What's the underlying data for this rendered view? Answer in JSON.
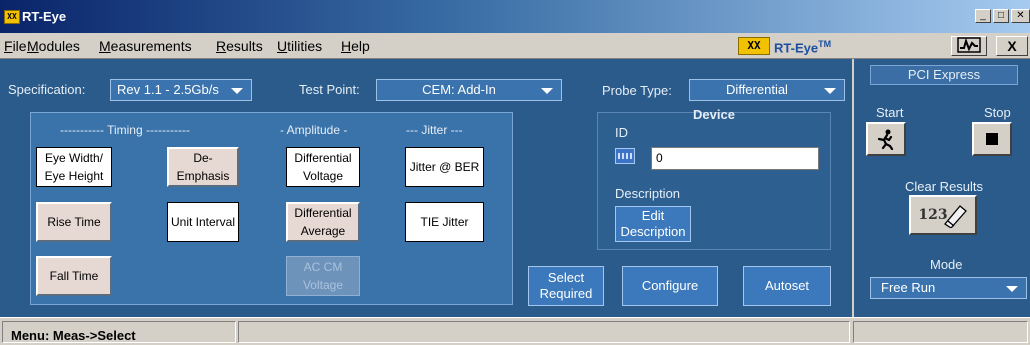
{
  "window": {
    "title": "RT-Eye",
    "logo_text": "XX",
    "controls": [
      "_",
      "□",
      "✕"
    ]
  },
  "menu": {
    "items": [
      "File",
      "Modules",
      "Measurements",
      "Results",
      "Utilities",
      "Help"
    ],
    "brand_logo": "XX",
    "brand_name": "RT-Eye",
    "brand_tm": "TM",
    "close_label": "X"
  },
  "settings": {
    "specification_label": "Specification:",
    "specification_value": "Rev 1.1 - 2.5Gb/s",
    "test_point_label": "Test Point:",
    "test_point_value": "CEM: Add-In",
    "probe_type_label": "Probe Type:",
    "probe_type_value": "Differential"
  },
  "measurements": {
    "groups": {
      "timing": "----------- Timing -----------",
      "amplitude": "- Amplitude -",
      "jitter": "--- Jitter ---"
    },
    "buttons": {
      "eye_width": "Eye Width/ Eye Height",
      "de_emphasis": "De- Emphasis",
      "rise_time": "Rise Time",
      "unit_interval": "Unit Interval",
      "fall_time": "Fall Time",
      "diff_voltage": "Differential Voltage",
      "diff_average": "Differential Average",
      "ac_cm_voltage": "AC CM Voltage",
      "jitter_ber": "Jitter @ BER",
      "tie_jitter": "TIE Jitter"
    }
  },
  "device": {
    "title": "Device",
    "id_label": "ID",
    "id_value": "0",
    "description_label": "Description",
    "edit_description": "Edit Description"
  },
  "actions": {
    "select_required": "Select Required",
    "configure": "Configure",
    "autoset": "Autoset"
  },
  "control_panel": {
    "header": "PCI Express",
    "start_label": "Start",
    "stop_label": "Stop",
    "clear_results_label": "Clear Results",
    "clear_results_icon_text": "123",
    "mode_label": "Mode",
    "mode_value": "Free Run"
  },
  "status": {
    "text": "Menu: Meas->Select"
  },
  "colors": {
    "panel_bg": "#2a5b8a",
    "meas_box_bg": "#3a72aa",
    "dropdown_bg": "#3a73ad",
    "accent_tan": "#e6d8d2",
    "logo_yellow": "#f2c100"
  },
  "icons": {
    "start": "running-figure-icon",
    "stop": "stop-square-icon",
    "clear": "eraser-icon",
    "device": "keyboard-icon",
    "toolbar": "waveform-icon"
  }
}
